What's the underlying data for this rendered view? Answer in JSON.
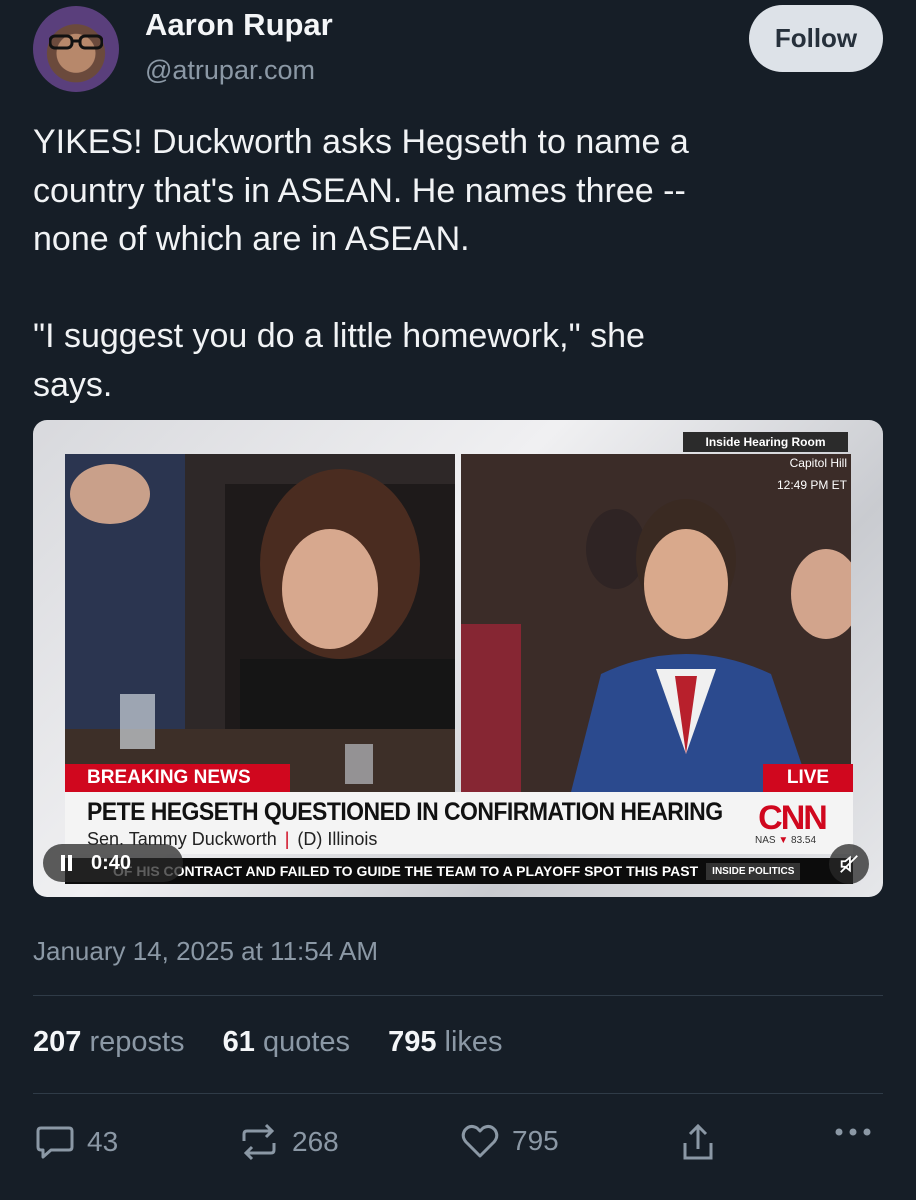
{
  "author": {
    "name": "Aaron Rupar",
    "handle": "@atrupar.com",
    "follow_label": "Follow"
  },
  "post": {
    "text": "YIKES! Duckworth asks Hegseth to name a\ncountry that's in ASEAN. He names three --\nnone of which are in ASEAN.\n\n\"I suggest you do a little homework,\" she\nsays.",
    "timestamp": "January 14, 2025 at 11:54 AM"
  },
  "video": {
    "location_tag": "Inside Hearing Room",
    "location_sub": "Capitol Hill",
    "time": "12:49 PM ET",
    "breaking_label": "BREAKING NEWS",
    "live_label": "LIVE",
    "headline": "PETE HEGSETH QUESTIONED IN CONFIRMATION HEARING",
    "subhead_name": "Sen. Tammy Duckworth",
    "subhead_sep": "|",
    "subhead_party": "(D) Illinois",
    "network": "CNN",
    "market_label": "NAS",
    "market_value": "83.54",
    "ticker": "OF HIS CONTRACT AND FAILED TO GUIDE THE TEAM TO A PLAYOFF SPOT THIS PAST",
    "ticker_tag": "INSIDE POLITICS",
    "elapsed": "0:40"
  },
  "stats": {
    "reposts_count": "207",
    "reposts_label": "reposts",
    "quotes_count": "61",
    "quotes_label": "quotes",
    "likes_count": "795",
    "likes_label": "likes"
  },
  "actions": {
    "replies": "43",
    "reposts": "268",
    "likes": "795"
  },
  "colors": {
    "background": "#161e27",
    "muted": "#8b98a5",
    "cnn_red": "#d0071e"
  }
}
